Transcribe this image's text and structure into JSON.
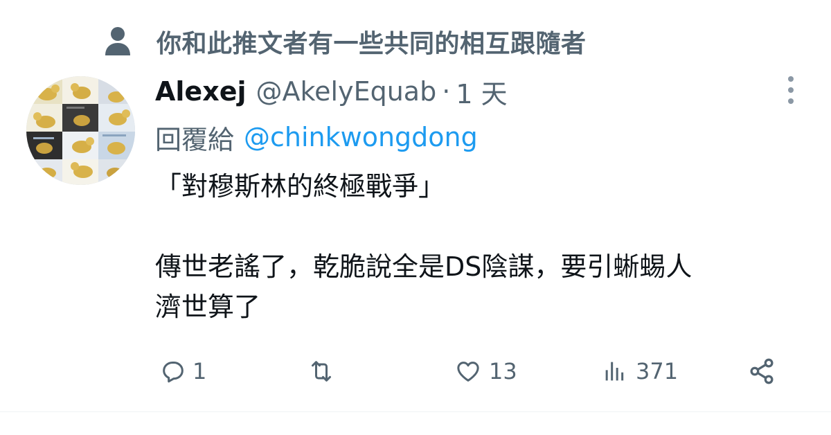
{
  "social_context": {
    "text": "你和此推文者有一些共同的相互跟隨者",
    "icon": "person-icon"
  },
  "tweet": {
    "author": {
      "display_name": "Alexej",
      "handle": "@AkelyEquab",
      "avatar": "avatar"
    },
    "separator": "·",
    "time": "1 天",
    "reply_to": {
      "label": "回覆給",
      "handle": "@chinkwongdong"
    },
    "text_lines": [
      "「對穆斯林的終極戰爭」",
      "",
      "傳世老謠了，乾脆說全是DS陰謀，要引蜥蜴人",
      "濟世算了"
    ],
    "actions": {
      "reply": {
        "icon": "reply-icon",
        "count": "1"
      },
      "retweet": {
        "icon": "retweet-icon",
        "count": ""
      },
      "like": {
        "icon": "heart-icon",
        "count": "13"
      },
      "views": {
        "icon": "views-chart-icon",
        "count": "371"
      },
      "share": {
        "icon": "share-icon"
      }
    },
    "more_icon": "more-vertical-icon"
  },
  "colors": {
    "text_primary": "#0f1419",
    "text_secondary": "#536471",
    "link": "#1d9bf0",
    "icon_muted": "#8b98a5"
  }
}
